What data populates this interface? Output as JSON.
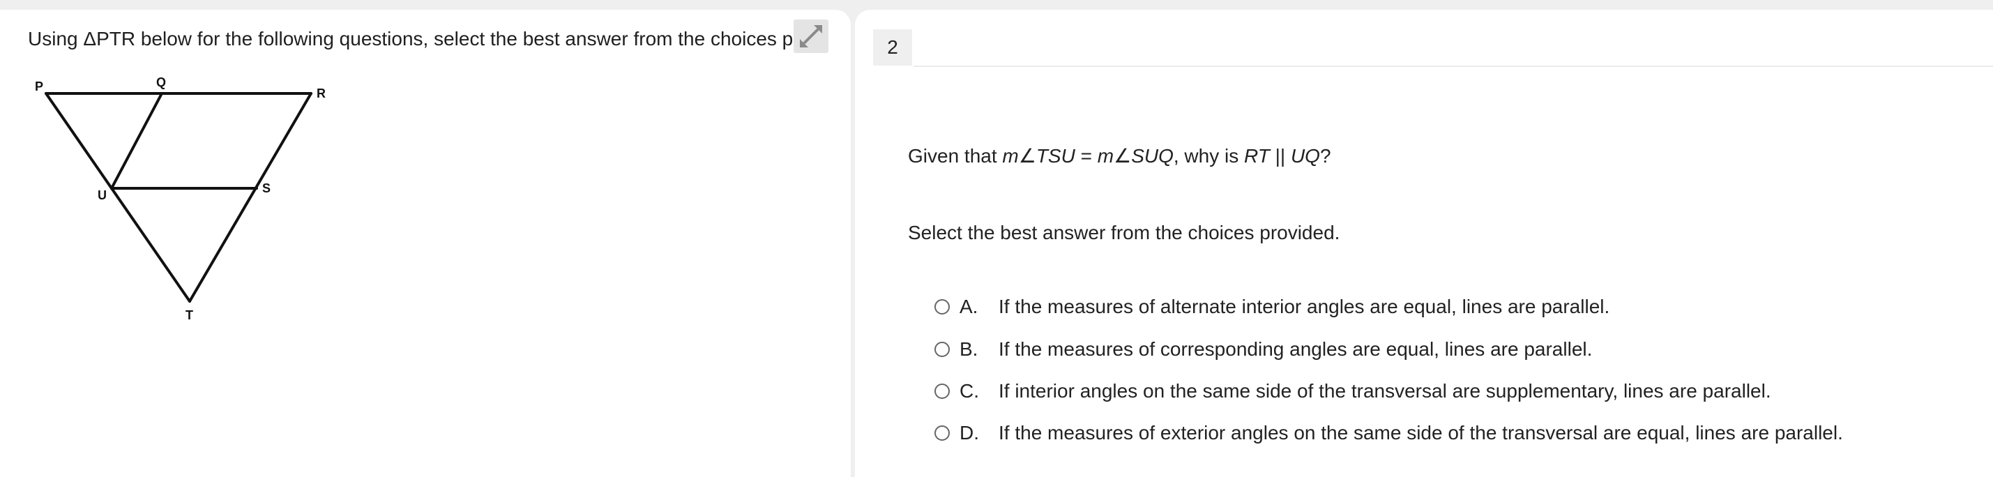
{
  "stimulus": {
    "text": "Using ΔPTR below for the following questions, select the best answer from the choices provided.",
    "figure_labels": {
      "P": "P",
      "Q": "Q",
      "R": "R",
      "U": "U",
      "S": "S",
      "T": "T"
    }
  },
  "question": {
    "number": "2",
    "stem": {
      "prefix": "Given that ",
      "angle1": "m∠TSU",
      "equals": " = ",
      "angle2": "m∠SUQ",
      "middle": ", why is ",
      "line1": "RT",
      "parallel": " || ",
      "line2": "UQ",
      "suffix": "?"
    },
    "instruction": "Select the best answer from the choices provided.",
    "choices": [
      {
        "letter": "A.",
        "text": "If the measures of alternate interior angles are equal, lines are parallel."
      },
      {
        "letter": "B.",
        "text": "If the measures of corresponding angles are equal, lines are parallel."
      },
      {
        "letter": "C.",
        "text": "If interior angles on the same side of the transversal are supplementary, lines are parallel."
      },
      {
        "letter": "D.",
        "text": "If the measures of exterior angles on the same side of the transversal are equal, lines are parallel."
      }
    ]
  },
  "icons": {
    "expand": "expand-arrows-icon",
    "radio": "radio-unselected-icon"
  },
  "colors": {
    "background": "#efefef",
    "panel": "#ffffff",
    "number_box": "#efefef",
    "expand_button": "#e4e4e4"
  }
}
